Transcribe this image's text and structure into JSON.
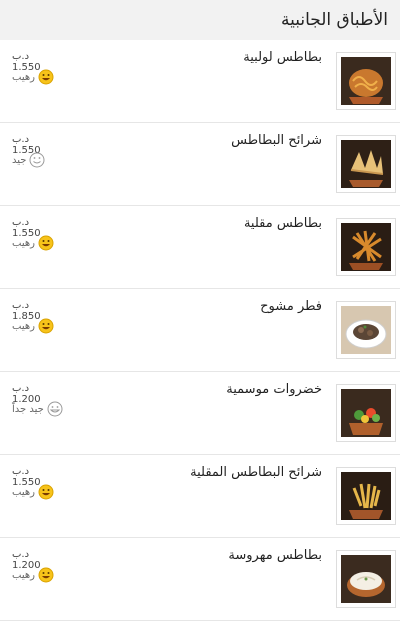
{
  "header": {
    "title": "الأطباق الجانبية"
  },
  "currency": "د.ب",
  "items": [
    {
      "name": "بطاطس لولبية",
      "price": "1.550",
      "rating": "رهيب",
      "face": "happy"
    },
    {
      "name": "شرائح البطاطس",
      "price": "1.550",
      "rating": "جيد",
      "face": "smile"
    },
    {
      "name": "بطاطس مقلية",
      "price": "1.550",
      "rating": "رهيب",
      "face": "happy"
    },
    {
      "name": "فطر مشوح",
      "price": "1.850",
      "rating": "رهيب",
      "face": "happy"
    },
    {
      "name": "خضروات موسمية",
      "price": "1.200",
      "rating": "جيد جداً",
      "face": "grin-outline"
    },
    {
      "name": "شرائح البطاطس المقلية",
      "price": "1.550",
      "rating": "رهيب",
      "face": "happy"
    },
    {
      "name": "بطاطس مهروسة",
      "price": "1.200",
      "rating": "رهيب",
      "face": "happy"
    }
  ]
}
